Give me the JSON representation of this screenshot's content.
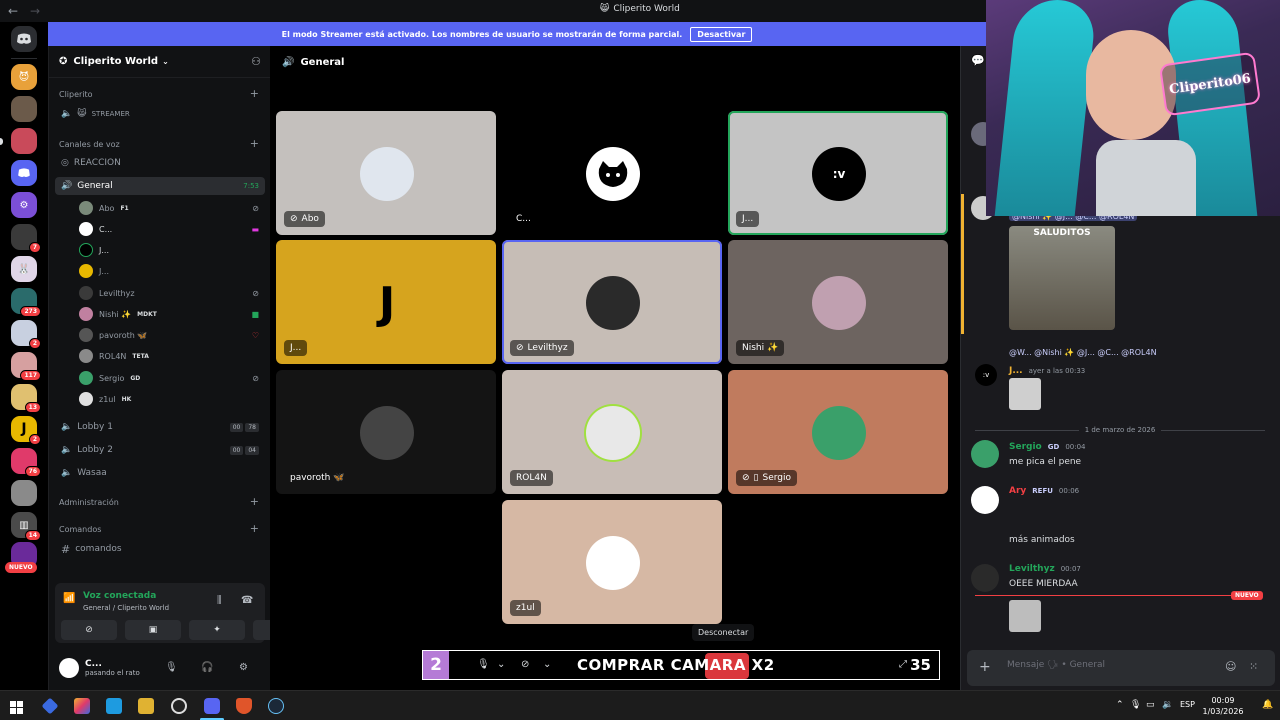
{
  "window": {
    "title": "Cliperito World"
  },
  "banner": {
    "text": "El modo Streamer está activado. Los nombres de usuario se mostrarán de forma parcial.",
    "button": "Desactivar"
  },
  "guilds": {
    "badges": [
      "",
      "",
      "",
      "7",
      "",
      "273",
      "",
      "117",
      "13",
      "2",
      "76",
      "",
      "14"
    ],
    "new_label": "NUEVO"
  },
  "sidebar": {
    "server_name": "Cliperito World",
    "cat_cliperito": "Cliperito",
    "streamer_label": "STREAMER",
    "cat_voice": "Canales de voz",
    "channels": {
      "reaccion": "REACCION",
      "general": "General",
      "general_time": "7:53",
      "lobby1": "Lobby 1",
      "lobby2": "Lobby 2",
      "wasaa": "Wasaa",
      "comandos": "comandos"
    },
    "lobby1_counts": [
      "00",
      "78"
    ],
    "lobby2_counts": [
      "00",
      "04"
    ],
    "voice_users": [
      {
        "name": "Abo",
        "tag": "F1"
      },
      {
        "name": "C...",
        "tag": ""
      },
      {
        "name": "J...",
        "tag": ""
      },
      {
        "name": "J...",
        "tag": ""
      },
      {
        "name": "Levilthyz",
        "tag": ""
      },
      {
        "name": "Nishi ✨",
        "tag": "MDKT"
      },
      {
        "name": "pavoroth 🦋",
        "tag": ""
      },
      {
        "name": "ROL4N",
        "tag": "TETA"
      },
      {
        "name": "Sergio",
        "tag": "GD"
      },
      {
        "name": "z1ul",
        "tag": "HK"
      }
    ],
    "cat_admin": "Administración",
    "cat_commands": "Comandos",
    "voice_connected": "Voz conectada",
    "voice_location": "General / Cliperito World",
    "user_name": "C...",
    "user_status": "pasando el rato"
  },
  "main": {
    "channel": "General",
    "tiles": [
      {
        "name": "Abo"
      },
      {
        "name": "C..."
      },
      {
        "name": "J...",
        "avatar_text": ":v"
      },
      {
        "name": "J...",
        "letter": "J"
      },
      {
        "name": "Levilthyz"
      },
      {
        "name": "Nishi ✨"
      },
      {
        "name": "pavoroth 🦋"
      },
      {
        "name": "ROL4N"
      },
      {
        "name": "Sergio"
      },
      {
        "name": "z1ul"
      }
    ],
    "tooltip": "Desconectar",
    "overlay": {
      "left_number": "2",
      "promo": "COMPRAR CAMARA X2",
      "right_number": "35"
    }
  },
  "chat": {
    "reply_mentions": "@Nishi ✨ @J... @C... @ROL4N",
    "sticker_text": "SALUDITOS",
    "reply2": "@W... @Nishi ✨ @J... @C... @ROL4N",
    "msg0_author": "J...",
    "msg0_time": "ayer a las 00:33",
    "avatar_text": ":v",
    "date_divider": "1 de marzo de 2026",
    "messages": [
      {
        "author": "Sergio",
        "tag": "GD",
        "time": "00:04",
        "text": "me pica el pene"
      },
      {
        "author": "Ary",
        "tag": "REFU",
        "time": "00:06",
        "text": "más animados"
      },
      {
        "author": "Levilthyz",
        "tag": "",
        "time": "00:07",
        "text": "OEEE MIERDAA"
      }
    ],
    "new_label": "NUEVO",
    "placeholder": "Mensaje 🗣 • General"
  },
  "webcam": {
    "sign": "Cliperito06"
  },
  "taskbar": {
    "lang": "ESP",
    "time": "00:09",
    "date": "1/03/2026"
  },
  "colors": {
    "blurple": "#5865f2",
    "green": "#23a55a",
    "red": "#da373c",
    "bg": "#000000"
  }
}
